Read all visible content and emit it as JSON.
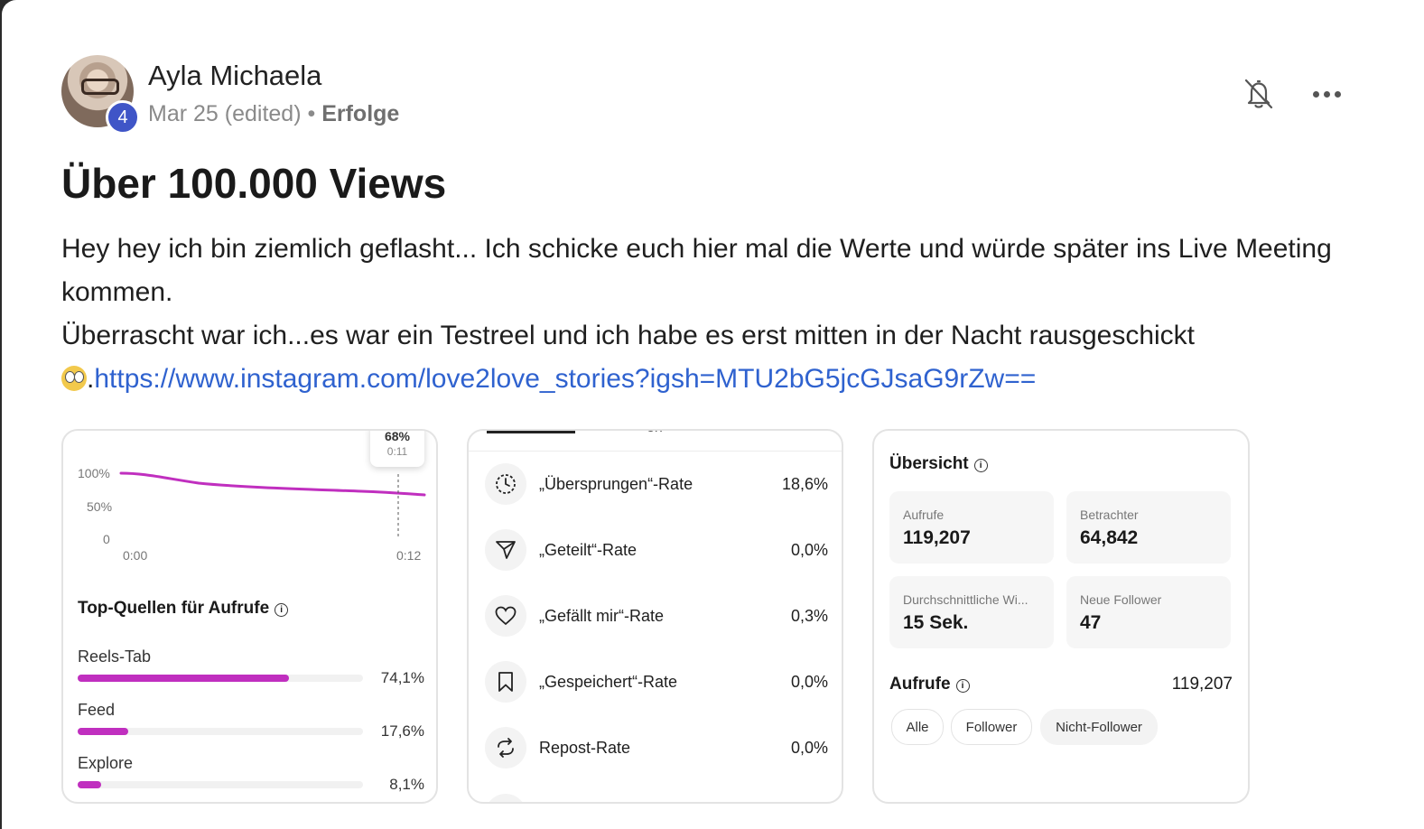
{
  "post": {
    "author": "Ayla Michaela",
    "level": "4",
    "date": "Mar 25 (edited)",
    "separator": "•",
    "category": "Erfolge",
    "title": "Über 100.000 Views",
    "body_line1": "Hey hey ich bin ziemlich geflasht... Ich schicke euch hier mal die Werte und würde später ins Live Meeting kommen.",
    "body_line2": "Überrascht war ich...es war ein Testreel und ich habe es erst mitten in der Nacht rausgeschickt",
    "body_dot": ".",
    "link": "https://www.instagram.com/love2love_stories?igsh=MTU2bG5jcGJsaG9rZw=="
  },
  "panel1": {
    "tooltip_pct": "68%",
    "tooltip_time": "0:11",
    "y_labels": [
      "100%",
      "50%",
      "0"
    ],
    "x_labels": [
      "0:00",
      "0:12"
    ],
    "sources_title": "Top-Quellen für Aufrufe",
    "info": "i",
    "sources": [
      {
        "label": "Reels-Tab",
        "pct": "74,1%",
        "value": 74.1
      },
      {
        "label": "Feed",
        "pct": "17,6%",
        "value": 17.6
      },
      {
        "label": "Explore",
        "pct": "8,1%",
        "value": 8.1
      }
    ],
    "line_color": "#c02fbf"
  },
  "panel2": {
    "tab_partial": "en",
    "rows": [
      {
        "icon": "skip-clock-icon",
        "label": "„Übersprungen“-Rate",
        "value": "18,6%"
      },
      {
        "icon": "share-icon",
        "label": "„Geteilt“-Rate",
        "value": "0,0%"
      },
      {
        "icon": "heart-icon",
        "label": "„Gefällt mir“-Rate",
        "value": "0,3%"
      },
      {
        "icon": "bookmark-icon",
        "label": "„Gespeichert“-Rate",
        "value": "0,0%"
      },
      {
        "icon": "repost-icon",
        "label": "Repost-Rate",
        "value": "0,0%"
      }
    ]
  },
  "panel3": {
    "title": "Übersicht",
    "info": "i",
    "tiles": [
      {
        "label": "Aufrufe",
        "value": "119,207"
      },
      {
        "label": "Betrachter",
        "value": "64,842"
      },
      {
        "label": "Durchschnittliche Wi...",
        "value": "15 Sek."
      },
      {
        "label": "Neue Follower",
        "value": "47"
      }
    ],
    "aufrufe_title": "Aufrufe",
    "aufrufe_value": "119,207",
    "chips": [
      "Alle",
      "Follower",
      "Nicht-Follower"
    ]
  }
}
